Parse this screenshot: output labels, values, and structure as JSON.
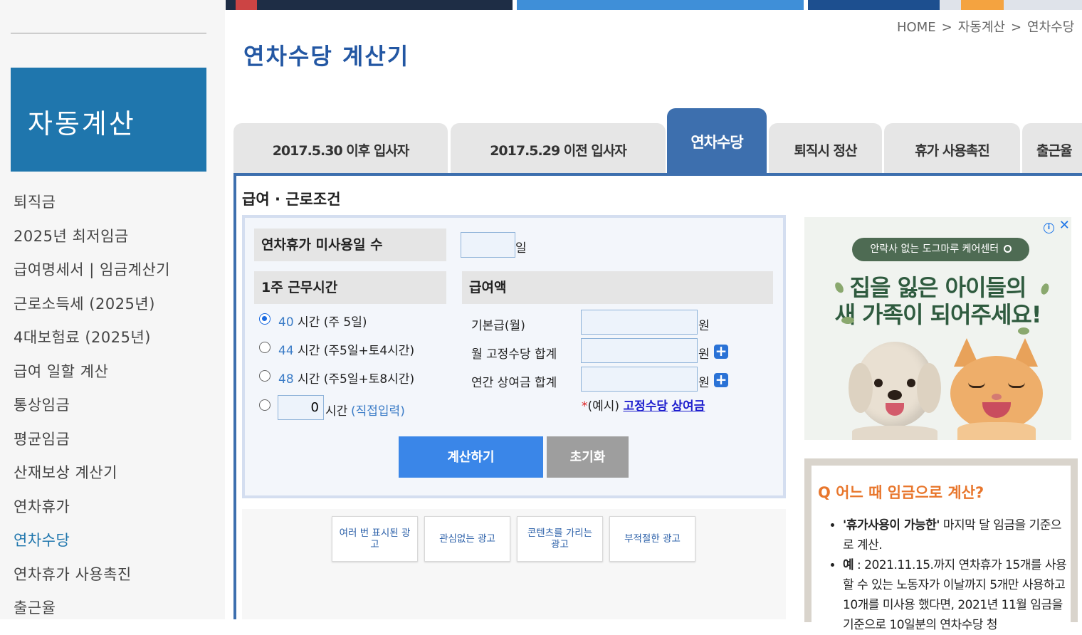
{
  "sidebar": {
    "brand": "자동계산",
    "items": [
      "퇴직금",
      "2025년 최저임금",
      "급여명세서 | 임금계산기",
      "근로소득세 (2025년)",
      "4대보험료 (2025년)",
      "급여 일할 계산",
      "통상임금",
      "평균임금",
      "산재보상 계산기",
      "연차휴가",
      "연차수당",
      "연차휴가 사용촉진",
      "출근율"
    ]
  },
  "breadcrumb": {
    "home": "HOME",
    "sep": ">",
    "level1": "자동계산",
    "level2": "연차수당"
  },
  "page_title": "연차수당 계산기",
  "tabs": [
    "2017.5.30 이후 입사자",
    "2017.5.29 이전 입사자",
    "연차수당",
    "퇴직시 정산",
    "휴가 사용촉진",
    "출근율"
  ],
  "form": {
    "section_title": "급여 · 근로조건",
    "unused_days_label": "연차휴가 미사용일 수",
    "unused_days_value": "",
    "day_unit": "일",
    "weekly_hours_label": "1주 근무시간",
    "hours_unit": "시간",
    "hour_options": [
      {
        "hours": "40",
        "desc": "(주 5일)",
        "selected": true
      },
      {
        "hours": "44",
        "desc": "(주5일+토4시간)",
        "selected": false
      },
      {
        "hours": "48",
        "desc": "(주5일+토8시간)",
        "selected": false
      }
    ],
    "custom_hours_value": "0",
    "custom_hours_hint": "(직접입력)",
    "pay_label": "급여액",
    "pay_fields": [
      "기본급(월)",
      "월 고정수당 합계",
      "연간 상여금 합계"
    ],
    "won_unit": "원",
    "example_star": "*",
    "example_prefix": "(예시)",
    "example_link1": "고정수당",
    "example_link2": "상여금",
    "calc_button": "계산하기",
    "reset_button": "초기화"
  },
  "ad_feedback": [
    "여러 번 표시된 광고",
    "관심없는 광고",
    "콘텐츠를 가리는 광고",
    "부적절한 광고"
  ],
  "ad": {
    "pill": "안락사 없는 도그마루 케어센터",
    "line1": "집을 잃은 아이들의",
    "line2": "새 가족이 되어주세요!"
  },
  "q_panel": {
    "title": "Q 어느 때 임금으로 계산?",
    "item1_bold": "'휴가사용이 가능한'",
    "item1_rest": " 마지막 달 임금을 기준으로 계산.",
    "item2_bold": "예",
    "item2_rest": " : 2021.11.15.까지 연차휴가 15개를 사용할 수 있는 노동자가 이날까지 5개만 사용하고 10개를 미사용 했다면, 2021년 11월 임금을 기준으로 10일분의 연차수당 청"
  },
  "colors": {
    "accent": "#3d6fae",
    "brand": "#1f76ad",
    "calc": "#3a86e8",
    "q_title": "#e8762c"
  }
}
